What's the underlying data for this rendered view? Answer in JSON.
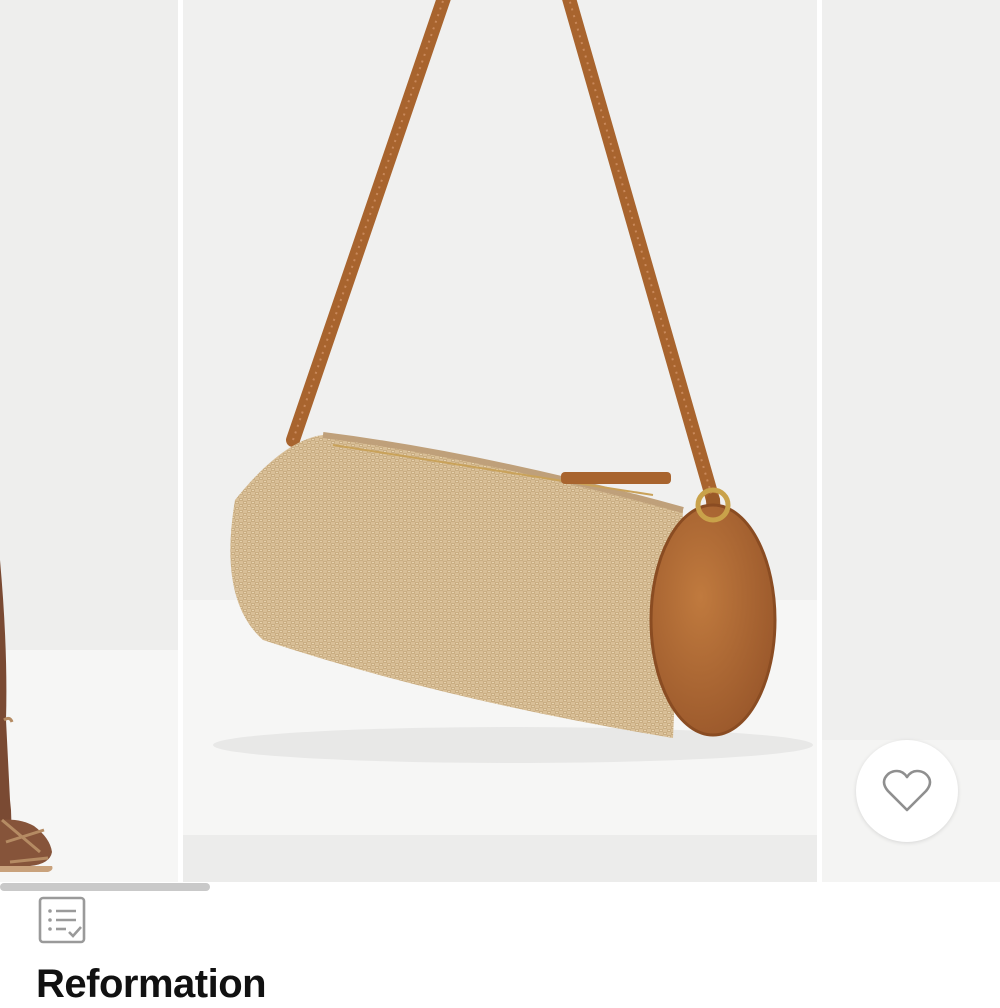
{
  "product": {
    "brand": "Reformation",
    "favorited": false
  },
  "gallery": {
    "images": [
      {
        "name": "model-wearing-sandals-photo"
      },
      {
        "name": "raffia-barrel-bag-photo"
      },
      {
        "name": "next-product-photo"
      }
    ],
    "scroll_progress": 0.21
  },
  "icons": {
    "favorite": "heart-outline-icon",
    "details": "list-checklist-icon"
  },
  "colors": {
    "raffia": "#d8be96",
    "leather": "#a8642e",
    "skin": "#7a4a33",
    "background": "#f0f0ef"
  }
}
